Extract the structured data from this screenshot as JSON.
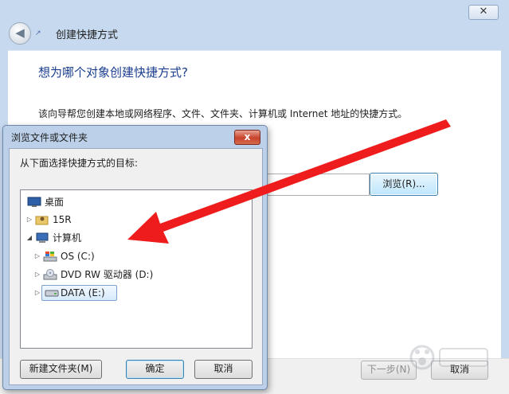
{
  "wizard": {
    "close_glyph": "✕",
    "back_glyph": "◀",
    "title": "创建快捷方式",
    "heading": "想为哪个对象创建快捷方式?",
    "description": "该向导帮您创建本地或网络程序、文件、文件夹、计算机或 Internet 地址的快捷方式。",
    "location_value": "",
    "browse_label": "浏览(R)...",
    "next_label": "下一步(N)",
    "cancel_label": "取消"
  },
  "browse_dialog": {
    "title": "浏览文件或文件夹",
    "close_glyph": "x",
    "prompt": "从下面选择快捷方式的目标:",
    "tree": [
      {
        "label": "桌面",
        "icon": "desktop-icon",
        "arrow": ""
      },
      {
        "label": "15R",
        "icon": "user-folder-icon",
        "arrow": "▷"
      },
      {
        "label": "计算机",
        "icon": "computer-icon",
        "arrow": "◢"
      },
      {
        "label": "OS (C:)",
        "icon": "windows-drive-icon",
        "arrow": "▷"
      },
      {
        "label": "DVD RW 驱动器 (D:)",
        "icon": "dvd-drive-icon",
        "arrow": "▷"
      },
      {
        "label": "DATA (E:)",
        "icon": "hard-drive-icon",
        "arrow": "▷",
        "selected": true
      }
    ],
    "new_folder_label": "新建文件夹(M)",
    "ok_label": "确定",
    "cancel_label": "取消"
  },
  "annotation": {
    "arrow_color": "#ee1c1c"
  }
}
